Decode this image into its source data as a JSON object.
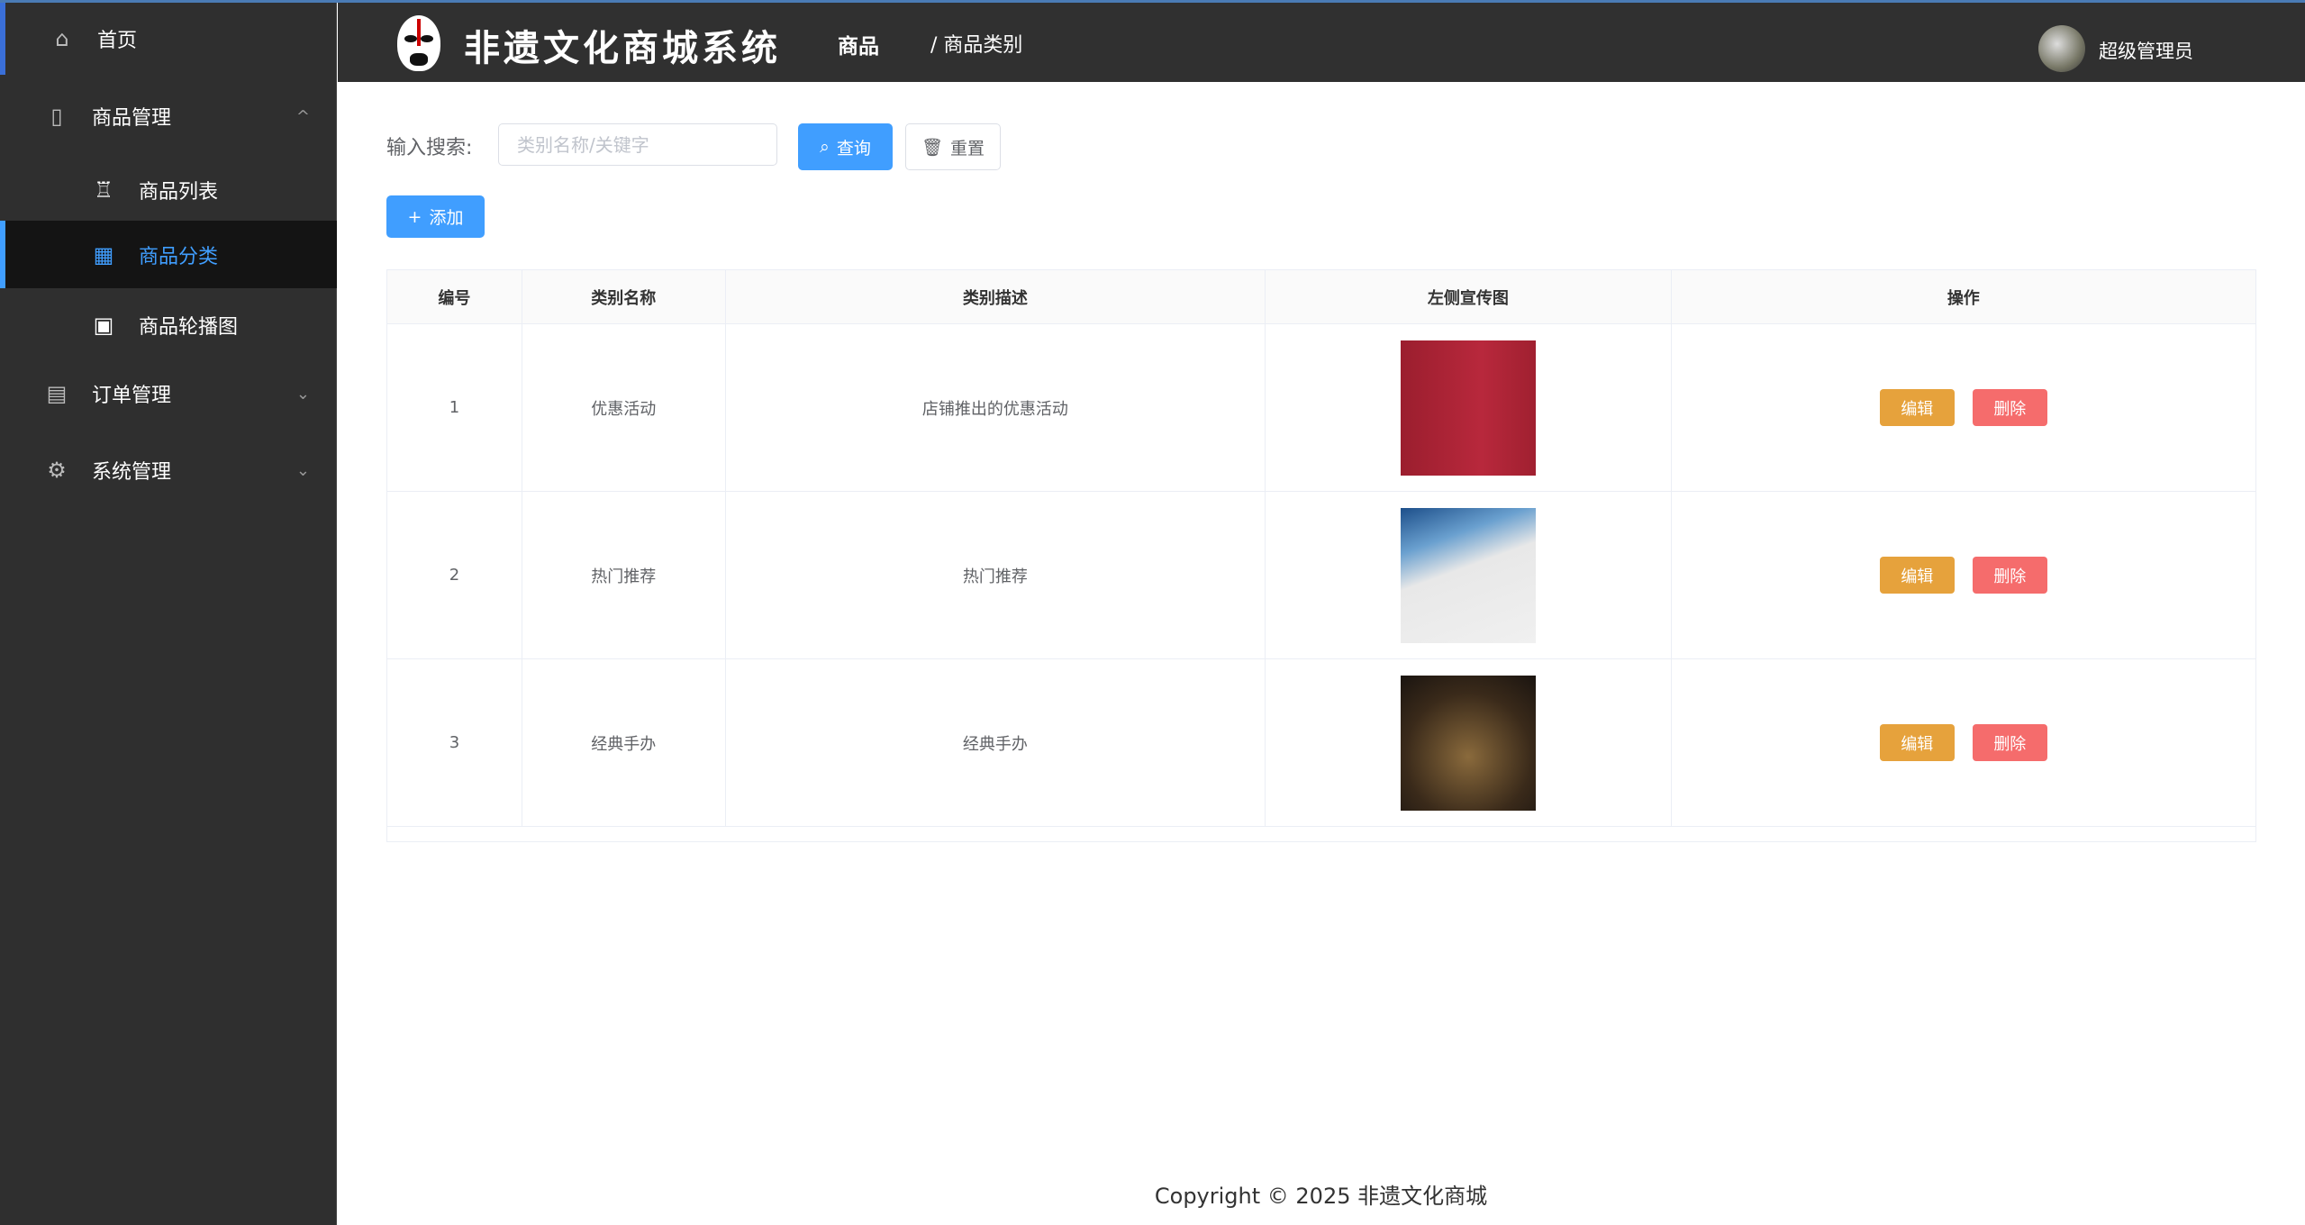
{
  "sidebar": {
    "items": [
      {
        "label": "首页",
        "icon": "home-icon"
      },
      {
        "label": "商品管理",
        "icon": "bag-icon",
        "arrow": "^"
      },
      {
        "label": "商品列表",
        "icon": "cup-icon"
      },
      {
        "label": "商品分类",
        "icon": "grid-icon"
      },
      {
        "label": "商品轮播图",
        "icon": "image-icon"
      },
      {
        "label": "订单管理",
        "icon": "clipboard-icon",
        "arrow": "⌄"
      },
      {
        "label": "系统管理",
        "icon": "gear-icon",
        "arrow": "⌄"
      }
    ]
  },
  "header": {
    "title": "非遗文化商城系统",
    "breadcrumb1": "商品",
    "breadcrumb2": "/ 商品类别",
    "user": "超级管理员"
  },
  "search": {
    "label": "输入搜索:",
    "placeholder": "类别名称/关键字",
    "query": "查询",
    "reset": "重置",
    "add": "添加"
  },
  "table": {
    "headers": [
      "编号",
      "类别名称",
      "类别描述",
      "左侧宣传图",
      "操作"
    ],
    "rows": [
      {
        "id": "1",
        "name": "优惠活动",
        "desc": "店铺推出的优惠活动"
      },
      {
        "id": "2",
        "name": "热门推荐",
        "desc": "热门推荐"
      },
      {
        "id": "3",
        "name": "经典手办",
        "desc": "经典手办"
      }
    ],
    "edit": "编辑",
    "delete": "删除"
  },
  "footer": "Copyright ©  2025   非遗文化商城",
  "colors": {
    "accent": "#409eff",
    "edit": "#e6a23c",
    "delete": "#f56c6c",
    "sidebar": "#2f2f2f"
  }
}
